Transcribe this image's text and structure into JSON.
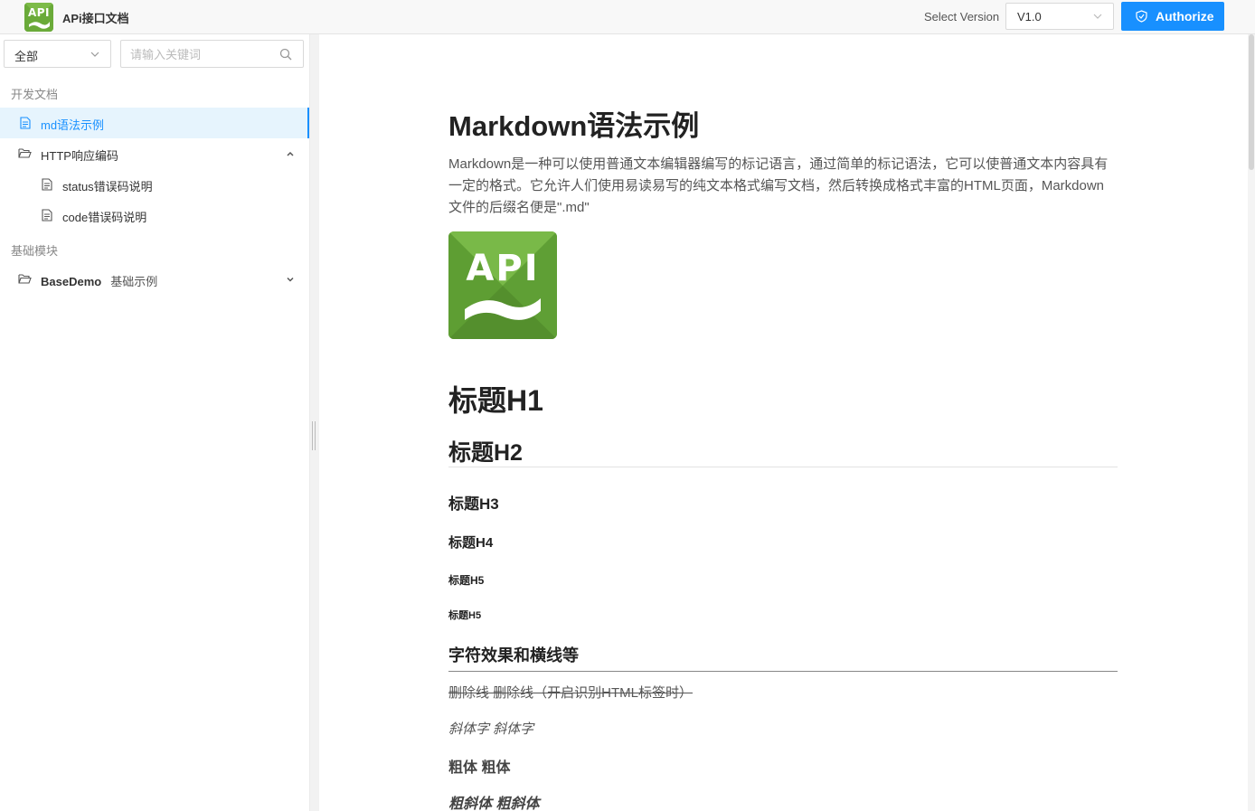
{
  "header": {
    "logo_text": "API",
    "title": "APi接口文档",
    "version_label": "Select Version",
    "version_value": "V1.0",
    "authorize_label": "Authorize"
  },
  "sidebar": {
    "filter_value": "全部",
    "search_placeholder": "请输入关键词",
    "groups": [
      {
        "label": "开发文档",
        "items": [
          {
            "label": "md语法示例",
            "active": true
          },
          {
            "label": "HTTP响应编码",
            "expanded": true,
            "children": [
              {
                "label": "status错误码说明"
              },
              {
                "label": "code错误码说明"
              }
            ]
          }
        ]
      },
      {
        "label": "基础模块",
        "items": [
          {
            "label": "BaseDemo",
            "sublabel": "基础示例",
            "expanded": false
          }
        ]
      }
    ]
  },
  "doc": {
    "title": "Markdown语法示例",
    "intro": "Markdown是一种可以使用普通文本编辑器编写的标记语言，通过简单的标记语法，它可以使普通文本内容具有一定的格式。它允许人们使用易读易写的纯文本格式编写文档，然后转换成格式丰富的HTML页面，Markdown文件的后缀名便是\".md\"",
    "image_text": "API",
    "h1": "标题H1",
    "h2": "标题H2",
    "h3": "标题H3",
    "h4": "标题H4",
    "h5_a": "标题H5",
    "h5_b": "标题H5",
    "section_title": "字符效果和横线等",
    "strike_text": "删除线 删除线（开启识别HTML标签时）",
    "italic_text": "斜体字 斜体字",
    "bold_text": "粗体 粗体",
    "bold_italic_text": "粗斜体 粗斜体"
  },
  "colors": {
    "accent": "#1890ff",
    "logo_green": "#6aaa39",
    "active_bg": "#e6f4fd"
  }
}
